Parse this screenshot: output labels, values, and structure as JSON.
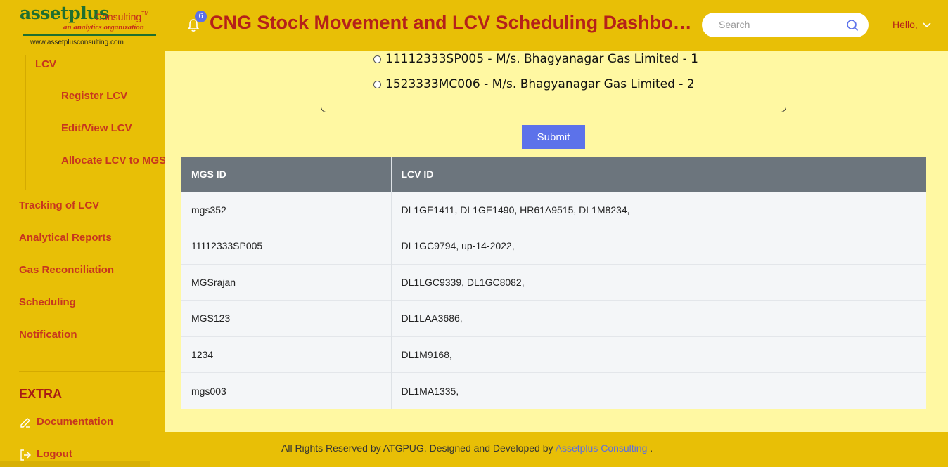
{
  "logo": {
    "brand": "assetplus",
    "consulting": "Consulting",
    "tm": "TM",
    "tagline": "an analytics organization",
    "url": "www.assetplusconsulting.com"
  },
  "sidebar": {
    "lcv": "LCV",
    "lcv_sub": [
      "Register LCV",
      "Edit/View LCV",
      "Allocate LCV to MGS"
    ],
    "items": [
      "Tracking of LCV",
      "Analytical Reports",
      "Gas Reconciliation",
      "Scheduling",
      "Notification"
    ],
    "extra_heading": "EXTRA",
    "documentation": "Documentation",
    "logout": "Logout"
  },
  "header": {
    "notification_count": "6",
    "title": "CNG Stock Movement and LCV Scheduling Dashboard",
    "search_placeholder": "Search",
    "greeting": "Hello,"
  },
  "form": {
    "options": [
      "11112333SP005 - M/s. Bhagyanagar Gas Limited - 1",
      "1523333MC006 - M/s. Bhagyanagar Gas Limited - 2"
    ],
    "submit_label": "Submit"
  },
  "table": {
    "headers": [
      "MGS ID",
      "LCV ID"
    ],
    "rows": [
      [
        "mgs352",
        "DL1GE1411, DL1GE1490, HR61A9515, DL1M8234,"
      ],
      [
        "11112333SP005",
        "DL1GC9794, up-14-2022,"
      ],
      [
        "MGSrajan",
        "DL1LGC9339, DL1GC8082,"
      ],
      [
        "MGS123",
        "DL1LAA3686,"
      ],
      [
        "1234",
        "DL1M9168,"
      ],
      [
        "mgs003",
        "DL1MA1335,"
      ]
    ]
  },
  "footer": {
    "text": "All Rights Reserved by ATGPUG. Designed and Developed by",
    "link": "Assetplus Consulting",
    "suffix": "."
  },
  "colors": {
    "sidebar_bg": "#e8bf06",
    "main_bg": "#fff8a2",
    "title_red": "#b5211a",
    "accent_blue": "#5c72ea",
    "table_header": "#6c757d"
  }
}
